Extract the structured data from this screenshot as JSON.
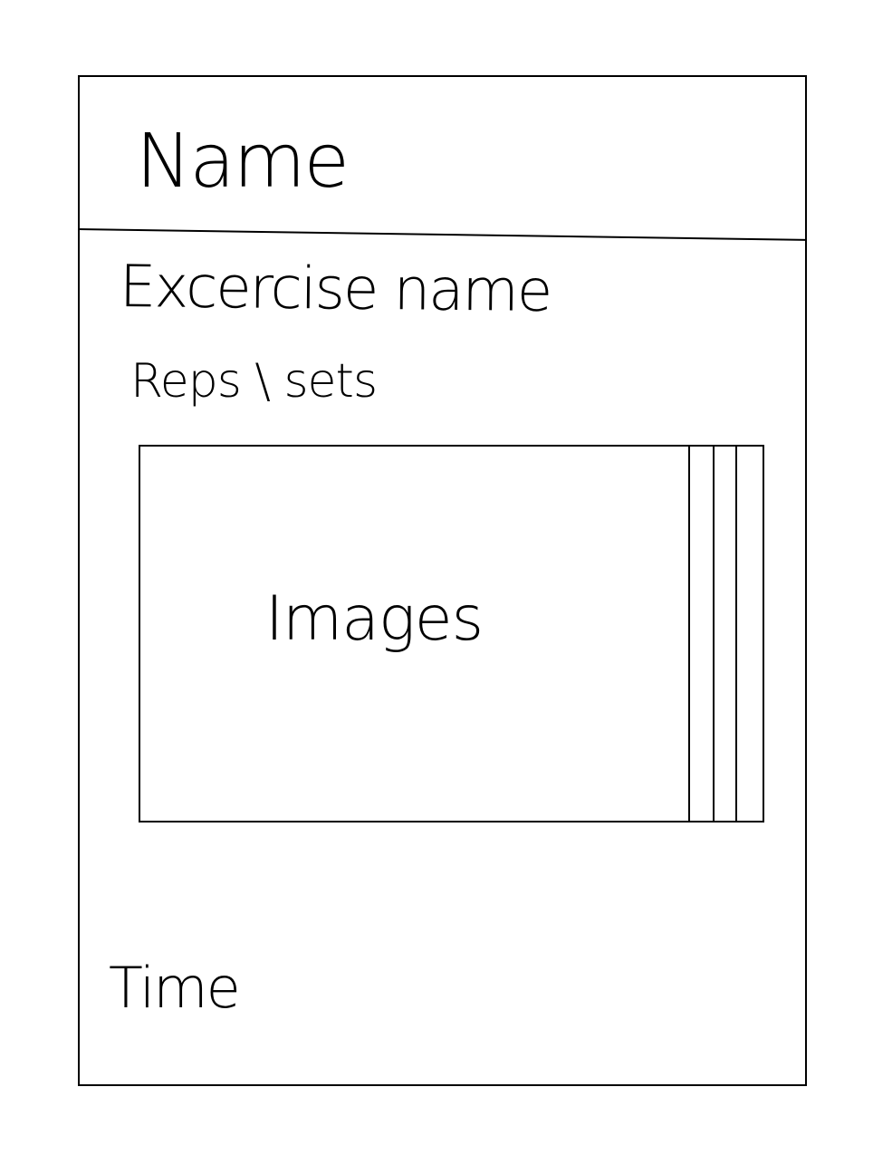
{
  "header": {
    "name_label": "Name"
  },
  "exercise": {
    "name_label": "Excercise name",
    "reps_sets_label": "Reps \\ sets"
  },
  "media": {
    "images_label": "Images"
  },
  "footer": {
    "time_label": "Time"
  }
}
